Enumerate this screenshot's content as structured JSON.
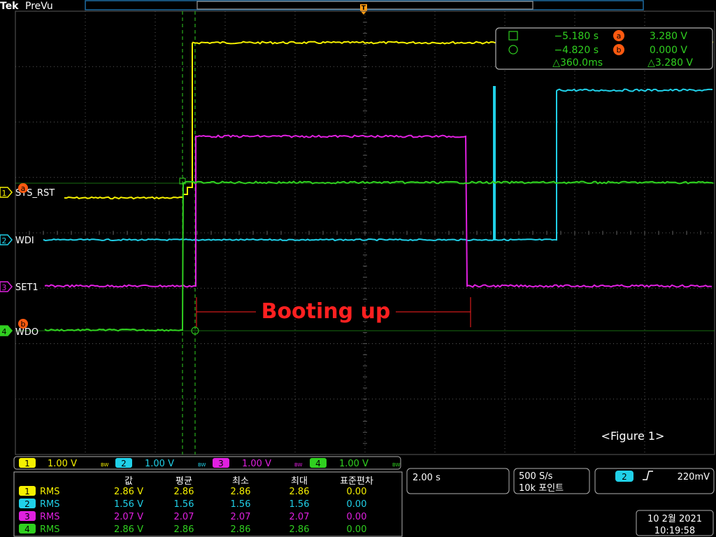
{
  "colors": {
    "ch1": "#f5f000",
    "ch2": "#20d0e8",
    "ch3": "#e020e0",
    "ch4": "#30d020",
    "grid": "#5a5a5a",
    "annotation": "#ff2020",
    "cursor_badge": "#ff5a10"
  },
  "header": {
    "brand": "Tek",
    "mode": "PreVu"
  },
  "channels": [
    {
      "number": "1",
      "label": "SYS_RST",
      "color": "#f5f000"
    },
    {
      "number": "2",
      "label": "WDI",
      "color": "#20d0e8"
    },
    {
      "number": "3",
      "label": "SET1",
      "color": "#e020e0"
    },
    {
      "number": "4",
      "label": "WDO",
      "color": "#30d020"
    }
  ],
  "cursor_readout": {
    "row1": {
      "icon": "square-cursor-icon",
      "time": "−5.180 s",
      "badge": "a",
      "volt": "3.280 V"
    },
    "row2": {
      "icon": "circle-cursor-icon",
      "time": "−4.820 s",
      "badge": "b",
      "volt": "0.000 V"
    },
    "row3": {
      "delta_time": "△360.0ms",
      "delta_volt": "△3.280 V"
    }
  },
  "annotation": {
    "text": "Booting up",
    "figure": "<Figure 1>"
  },
  "scale_bar": {
    "items": [
      {
        "ch": "1",
        "value": "1.00 V",
        "bw": "BW"
      },
      {
        "ch": "2",
        "value": "1.00 V",
        "bw": "BW"
      },
      {
        "ch": "3",
        "value": "1.00 V",
        "bw": "BW"
      },
      {
        "ch": "4",
        "value": "1.00 V",
        "bw": "BW"
      }
    ]
  },
  "measurements": {
    "headers": [
      "값",
      "평균",
      "최소",
      "최대",
      "표준편차"
    ],
    "rows": [
      {
        "ch": "1",
        "type": "RMS",
        "values": [
          "2.86 V",
          "2.86",
          "2.86",
          "2.86",
          "0.00"
        ]
      },
      {
        "ch": "2",
        "type": "RMS",
        "values": [
          "1.56 V",
          "1.56",
          "1.56",
          "1.56",
          "0.00"
        ]
      },
      {
        "ch": "3",
        "type": "RMS",
        "values": [
          "2.07 V",
          "2.07",
          "2.07",
          "2.07",
          "0.00"
        ]
      },
      {
        "ch": "4",
        "type": "RMS",
        "values": [
          "2.86 V",
          "2.86",
          "2.86",
          "2.86",
          "0.00"
        ]
      }
    ]
  },
  "timebase": {
    "horizontal": "2.00 s"
  },
  "acquisition": {
    "rate": "500 S/s",
    "points": "10k 포인트"
  },
  "trigger": {
    "source": "2",
    "slope_icon": "rising-edge-icon",
    "level": "220mV"
  },
  "datetime": {
    "date": "10 2월 2021",
    "time": "10:19:58"
  }
}
